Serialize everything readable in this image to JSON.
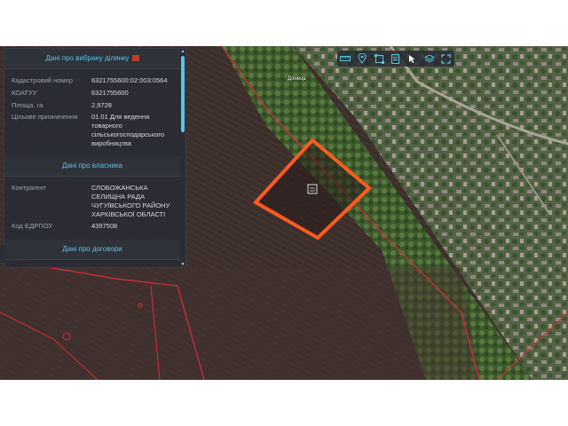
{
  "panel": {
    "section1_title": "Дані про вибрану ділянку",
    "parcel": [
      {
        "key": "Кадастровий номер",
        "value": "6321755600:02:003:0564"
      },
      {
        "key": "КОАТУУ",
        "value": "6321755600"
      },
      {
        "key": "Площа, га",
        "value": "2,9728"
      },
      {
        "key": "Цільове призначення",
        "value": "01.01 Для ведення товарного сільськогосподарського виробництва"
      }
    ],
    "section2_title": "Дані про власника",
    "owner": [
      {
        "key": "Контрагент",
        "value": "СЛОБОЖАНСЬКА СЕЛИЩНА РАДА ЧУГУЇВСЬКОГО РАЙОНУ ХАРКІВСЬКОЇ ОБЛАСТІ"
      },
      {
        "key": "Код ЄДРПОУ",
        "value": "4397508"
      }
    ],
    "section3_title": "Дані про договори"
  },
  "toolbar": {
    "icons": [
      "ruler-icon",
      "location-pin-icon",
      "selection-frame-icon",
      "document-icon",
      "pointer-icon",
      "layers-icon",
      "fullscreen-icon"
    ]
  },
  "map": {
    "place_label": "Донець",
    "selected_color": "#ff5a1f",
    "boundary_color": "#e0293a"
  }
}
